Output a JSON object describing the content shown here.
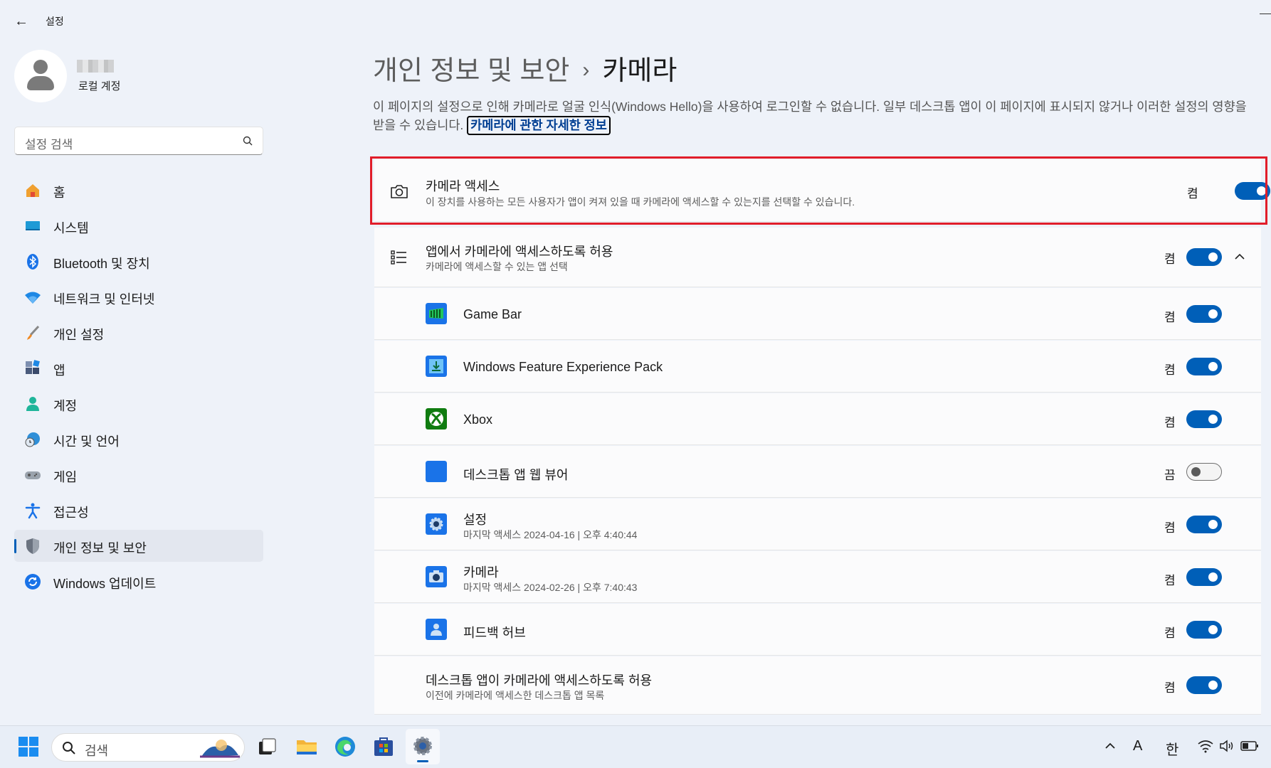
{
  "window": {
    "title": "설정",
    "back_icon": "back-arrow-icon"
  },
  "profile": {
    "account_type": "로컬 계정"
  },
  "search": {
    "placeholder": "설정 검색"
  },
  "nav": [
    {
      "label": "홈",
      "icon": "home-icon"
    },
    {
      "label": "시스템",
      "icon": "system-icon"
    },
    {
      "label": "Bluetooth 및 장치",
      "icon": "bluetooth-icon"
    },
    {
      "label": "네트워크 및 인터넷",
      "icon": "wifi-icon"
    },
    {
      "label": "개인 설정",
      "icon": "brush-icon"
    },
    {
      "label": "앱",
      "icon": "apps-icon"
    },
    {
      "label": "계정",
      "icon": "account-icon"
    },
    {
      "label": "시간 및 언어",
      "icon": "globe-clock-icon"
    },
    {
      "label": "게임",
      "icon": "gamepad-icon"
    },
    {
      "label": "접근성",
      "icon": "accessibility-icon"
    },
    {
      "label": "개인 정보 및 보안",
      "icon": "shield-icon",
      "active": true
    },
    {
      "label": "Windows 업데이트",
      "icon": "update-icon"
    }
  ],
  "page": {
    "breadcrumb_parent": "개인 정보 및 보안",
    "breadcrumb_sep": "›",
    "breadcrumb_current": "카메라",
    "description": "이 페이지의 설정으로 인해 카메라로 얼굴 인식(Windows Hello)을 사용하여 로그인할 수 없습니다. 일부 데스크톱 앱이 이 페이지에 표시되지 않거나 이러한 설정의 영향을 받을 수 있습니다.",
    "learn_more": "카메라에 관한 자세한 정보"
  },
  "camera_access": {
    "title": "카메라 액세스",
    "subtitle": "이 장치를 사용하는 모든 사용자가 앱이 켜져 있을 때 카메라에 액세스할 수 있는지를 선택할 수 있습니다.",
    "state": "켬",
    "on": true
  },
  "app_access": {
    "title": "앱에서 카메라에 액세스하도록 허용",
    "subtitle": "카메라에 액세스할 수 있는 앱 선택",
    "state": "켬",
    "on": true,
    "expanded": true
  },
  "apps": [
    {
      "name": "Game Bar",
      "detail": "",
      "state": "켬",
      "on": true,
      "icon": "game-bar-icon",
      "color": "#107c10"
    },
    {
      "name": "Windows Feature Experience Pack",
      "detail": "",
      "state": "켬",
      "on": true,
      "icon": "feature-pack-icon",
      "color": "#0078d4"
    },
    {
      "name": "Xbox",
      "detail": "",
      "state": "켬",
      "on": true,
      "icon": "xbox-icon",
      "color": "#107c10"
    },
    {
      "name": "데스크톱 앱 웹 뷰어",
      "detail": "",
      "state": "끔",
      "on": false,
      "icon": "web-viewer-icon",
      "color": "#0078d4"
    },
    {
      "name": "설정",
      "detail": "마지막 액세스 2024-04-16  |  오후 4:40:44",
      "state": "켬",
      "on": true,
      "icon": "settings-gear-icon",
      "color": "#0078d4"
    },
    {
      "name": "카메라",
      "detail": "마지막 액세스 2024-02-26  |  오후 7:40:43",
      "state": "켬",
      "on": true,
      "icon": "camera-app-icon",
      "color": "#0078d4"
    },
    {
      "name": "피드백 허브",
      "detail": "",
      "state": "켬",
      "on": true,
      "icon": "feedback-hub-icon",
      "color": "#0078d4"
    }
  ],
  "desktop_access": {
    "title": "데스크톱 앱이 카메라에 액세스하도록 허용",
    "subtitle": "이전에 카메라에 액세스한 데스크톱 앱 목록",
    "state": "켬",
    "on": true
  },
  "taskbar": {
    "search_placeholder": "검색",
    "apps": [
      "start-icon",
      "task-view-icon",
      "file-explorer-icon",
      "edge-icon",
      "store-icon",
      "settings-icon"
    ],
    "tray": {
      "font_indicator": "A",
      "ime": "한"
    }
  },
  "colors": {
    "accent": "#005fb8",
    "highlight": "#e11d2a",
    "background": "#eef2f9"
  }
}
